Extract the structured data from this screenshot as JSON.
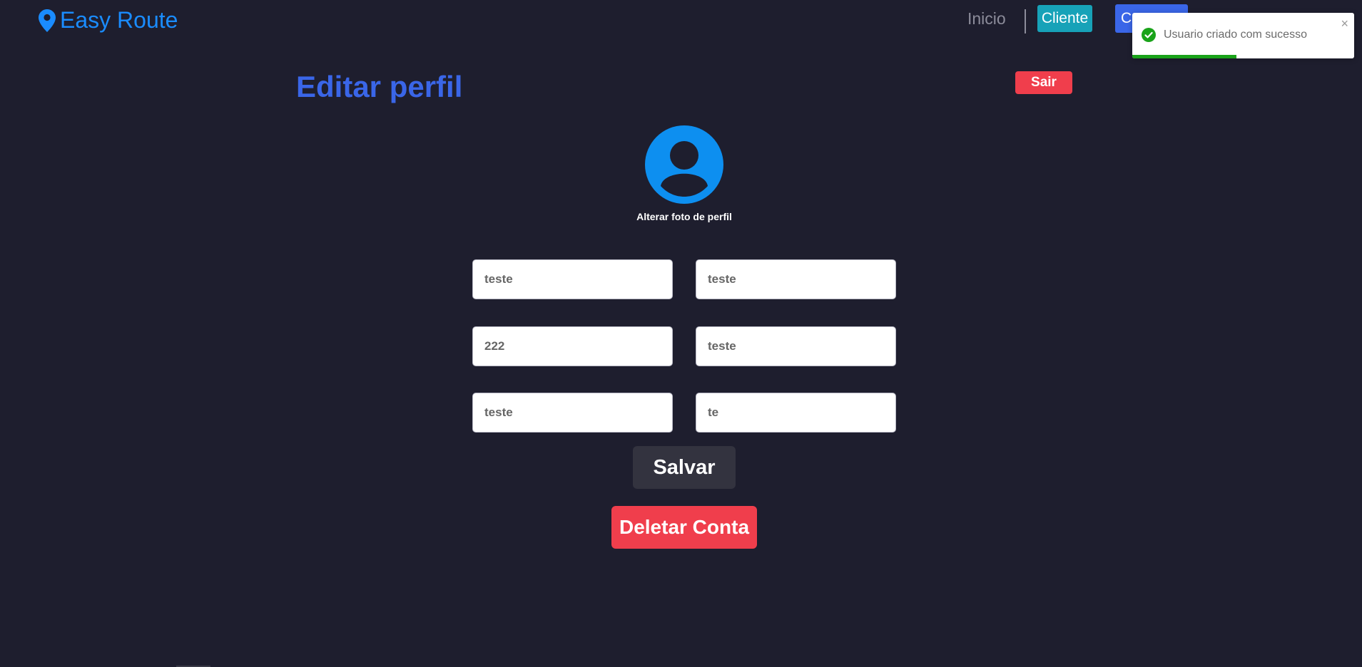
{
  "nav": {
    "brand": "Easy Route",
    "link_inicio": "Inicio",
    "btn_cliente": "Cliente",
    "btn_covered": "Ca"
  },
  "page": {
    "title": "Editar perfil",
    "logout_label": "Sair",
    "avatar_caption": "Alterar foto de perfil"
  },
  "form": {
    "fields": [
      {
        "value": "teste"
      },
      {
        "value": "teste"
      },
      {
        "value": "222"
      },
      {
        "value": "teste"
      },
      {
        "value": "teste"
      },
      {
        "value": "te"
      }
    ],
    "save_label": "Salvar",
    "delete_label": "Deletar Conta"
  },
  "toast": {
    "message": "Usuario criado com sucesso",
    "close": "×",
    "progress": 0.47
  },
  "colors": {
    "background": "#1e1e2e",
    "brand": "#1a8cff",
    "title": "#3a66e8",
    "danger": "#f03e4c",
    "info": "#17a2b8",
    "success": "#1aa31a"
  },
  "icons": {
    "brand": "map-pin-icon",
    "avatar": "user-circle-icon",
    "toast": "check-circle-icon",
    "close": "close-icon"
  }
}
